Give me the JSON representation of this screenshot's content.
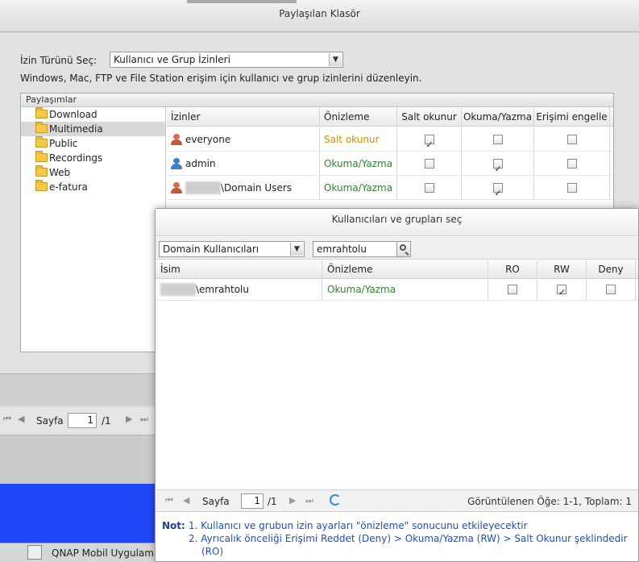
{
  "outer": {
    "title": "Paylaşılan Klasör",
    "perm_type_label": "İzin Türünü Seç:",
    "perm_type_value": "Kullanıcı ve Grup İzinleri",
    "description": "Windows, Mac, FTP ve File Station erişim için kullanıcı ve grup izinlerini düzenleyin.",
    "shares_header": "Paylaşımlar",
    "shares": [
      "Download",
      "Multimedia",
      "Public",
      "Recordings",
      "Web",
      "e-fatura"
    ],
    "grid_headers": [
      "İzinler",
      "Önizleme",
      "Salt okunur",
      "Okuma/Yazma",
      "Erişimi engelle"
    ],
    "rows": [
      {
        "name": "everyone",
        "preview": "Salt okunur",
        "ro": true,
        "rw": false,
        "deny": false
      },
      {
        "name": "admin",
        "preview": "Okuma/Yazma",
        "ro": false,
        "rw": true,
        "deny": false
      },
      {
        "name": "\\Domain Users",
        "preview": "Okuma/Yazma",
        "ro": false,
        "rw": true,
        "deny": false
      }
    ],
    "pager": {
      "page_label": "Sayfa",
      "page_value": "1",
      "page_total": "/1"
    }
  },
  "taskbar": {
    "label": "QNAP Mobil Uygulama"
  },
  "modal": {
    "title": "Kullanıcıları ve grupları seç",
    "domain_select": "Domain Kullanıcıları",
    "search_value": "emrahtolu",
    "grid_headers": [
      "İsim",
      "Önizleme",
      "RO",
      "RW",
      "Deny"
    ],
    "row": {
      "name": "\\emrahtolu",
      "preview": "Okuma/Yazma",
      "ro": false,
      "rw": true,
      "deny": false
    },
    "pager": {
      "page_label": "Sayfa",
      "page_value": "1",
      "page_total": "/1",
      "summary": "Görüntülenen Öğe: 1-1, Toplam: 1"
    },
    "note_label": "Not:",
    "notes": [
      "1. Kullanıcı ve grubun izin ayarları \"önizleme\" sonucunu etkileyecektir",
      "2. Ayrıcalık önceliği Erişimi Reddet (Deny) > Okuma/Yazma (RW) > Salt Okunur şeklindedir",
      "(RO)"
    ]
  },
  "colors": {
    "ro_text": "#d08f0a",
    "rw_text": "#2a8a2a",
    "desktop": "#1f47f5",
    "note_text": "#1f4fbf"
  }
}
